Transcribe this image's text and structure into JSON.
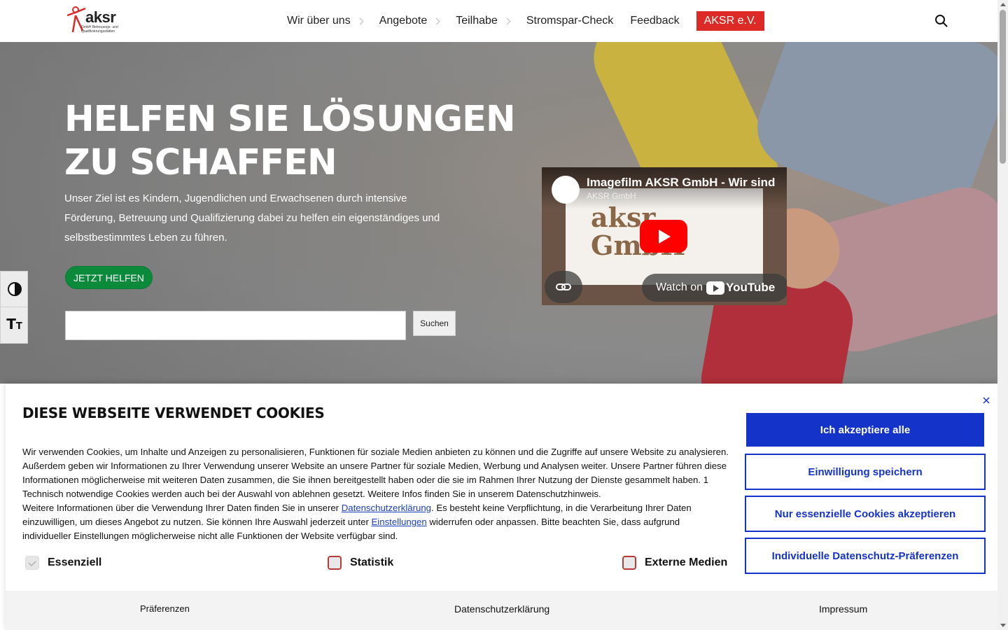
{
  "header": {
    "logo_text": "aksr",
    "logo_subtitle": "GmbH Betreuungs- und Qualifizierungsstätten",
    "nav": [
      {
        "label": "Wir über uns",
        "has_submenu": true
      },
      {
        "label": "Angebote",
        "has_submenu": true
      },
      {
        "label": "Teilhabe",
        "has_submenu": true
      },
      {
        "label": "Stromspar-Check",
        "has_submenu": false
      },
      {
        "label": "Feedback",
        "has_submenu": false
      }
    ],
    "cta_label": "AKSR e.V.",
    "cta_color": "#dd2a27",
    "search_icon": "search-icon"
  },
  "hero": {
    "title_line1": "HELFEN SIE LÖSUNGEN",
    "title_line2": "ZU SCHAFFEN",
    "text": "Unser Ziel ist es Kindern, Jugendlichen und Erwachsenen durch intensive Förderung, Betreuung und Qualifizierung dabei zu helfen ein eigenständiges und selbstbestimmtes Leben zu führen.",
    "button_label": "JETZT HELFEN",
    "button_color": "#0a8a3a",
    "search_value": "",
    "search_button_label": "Suchen"
  },
  "video": {
    "title": "Imagefilm AKSR GmbH - Wir sind",
    "channel": "AKSR GmbH",
    "brand_line1": "aksr",
    "brand_line2": "GmbH",
    "watch_label": "Watch on",
    "youtube_label": "YouTube"
  },
  "accessibility": {
    "contrast_icon": "contrast-icon",
    "font_size_icon": "text-size-icon"
  },
  "cookie": {
    "title": "DIESE WEBSEITE VERWENDET COOKIES",
    "text_p1": "Wir verwenden Cookies, um Inhalte und Anzeigen zu personalisieren, Funktionen für soziale Medien anbieten zu können und die Zugriffe auf unsere Website zu analysieren. Außerdem geben wir Informationen zu Ihrer Verwendung unserer Website an unsere Partner für soziale Medien, Werbung und Analysen weiter. Unsere Partner führen diese Informationen möglicherweise mit weiteren Daten zusammen, die Sie ihnen bereitgestellt haben oder die sie im Rahmen Ihrer Nutzung der Dienste gesammelt haben. 1 Technisch notwendige Cookies werden auch bei der Auswahl von ablehnen gesetzt. Weitere Infos finden Sie in unserem Datenschutzhinweis.",
    "text_p2_a": "Weitere Informationen über die Verwendung Ihrer Daten finden Sie in unserer ",
    "link_privacy": "Datenschutzerklärung",
    "text_p2_b": ". Es besteht keine Verpflichtung, in die Verarbeitung Ihrer Daten einzuwilligen, um dieses Angebot zu nutzen. Sie können Ihre Auswahl jederzeit unter ",
    "link_settings": "Einstellungen",
    "text_p2_c": " widerrufen oder anpassen. Bitte beachten Sie, dass aufgrund individueller Einstellungen möglicherweise nicht alle Funktionen der Website verfügbar sind.",
    "checkboxes": [
      {
        "label": "Essenziell",
        "checked": true,
        "disabled": true
      },
      {
        "label": "Statistik",
        "checked": false,
        "disabled": false
      },
      {
        "label": "Externe Medien",
        "checked": false,
        "disabled": false
      }
    ],
    "btn_accept_all": "Ich akzeptiere alle",
    "btn_save": "Einwilligung speichern",
    "btn_essential": "Nur essenzielle Cookies akzeptieren",
    "btn_individual": "Individuelle Datenschutz-Präferenzen",
    "accent_color": "#1433c8",
    "footer_links": [
      "Präferenzen",
      "Datenschutzerklärung",
      "Impressum"
    ]
  }
}
